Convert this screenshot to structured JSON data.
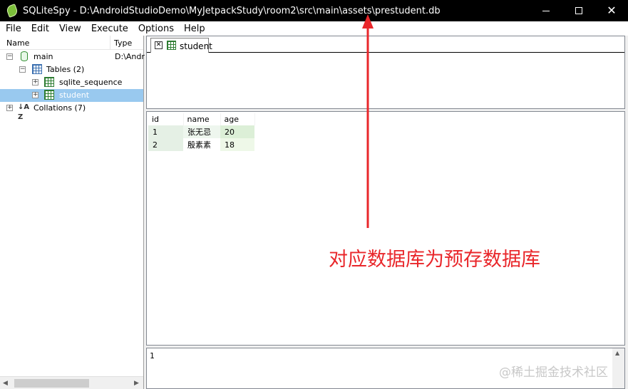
{
  "window": {
    "title": "SQLiteSpy - D:\\AndroidStudioDemo\\MyJetpackStudy\\room2\\src\\main\\assets\\prestudent.db",
    "controls": {
      "minimize": "minimize-icon",
      "maximize": "maximize-icon",
      "close": "✕"
    }
  },
  "menu": [
    "File",
    "Edit",
    "View",
    "Execute",
    "Options",
    "Help"
  ],
  "tree": {
    "headers": {
      "name": "Name",
      "type": "Type"
    },
    "items": [
      {
        "label": "main",
        "type": "D:\\Andr",
        "icon": "database-icon",
        "expander": "−"
      },
      {
        "label": "Tables (2)",
        "icon": "tables-icon",
        "expander": "−"
      },
      {
        "label": "sqlite_sequence",
        "icon": "table-icon",
        "expander": "+"
      },
      {
        "label": "student",
        "icon": "table-icon",
        "expander": "+",
        "selected": true
      },
      {
        "label": "Collations (7)",
        "icon": "collation-icon",
        "expander": "+",
        "icon_text": "↓A Z"
      }
    ]
  },
  "editor": {
    "tab": {
      "label": "student",
      "close": "✕"
    }
  },
  "result": {
    "columns": [
      "id",
      "name",
      "age"
    ],
    "rows": [
      [
        "1",
        "张无忌",
        "20"
      ],
      [
        "2",
        "殷素素",
        "18"
      ]
    ]
  },
  "messages": {
    "text": "1"
  },
  "annotation": {
    "text": "对应数据库为预存数据库",
    "color": "#e9272b"
  },
  "watermark": "@稀土掘金技术社区"
}
